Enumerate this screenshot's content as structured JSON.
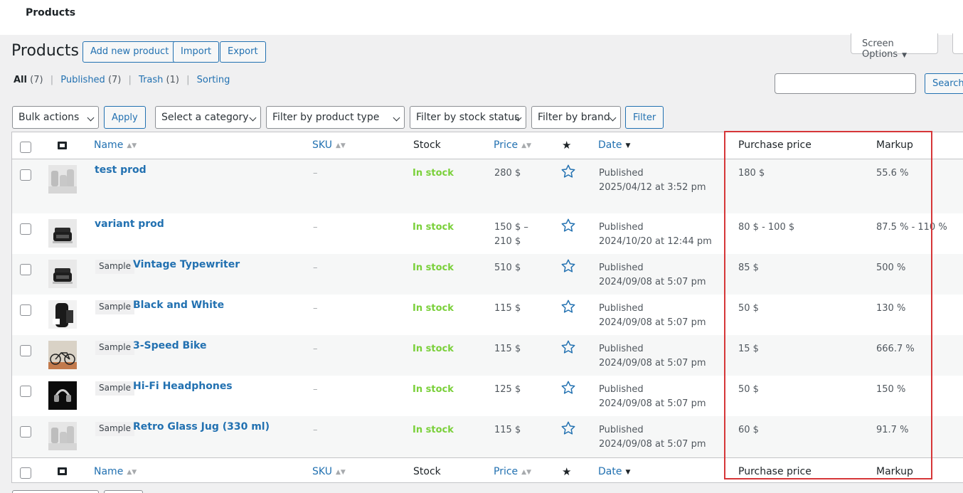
{
  "topbar": {
    "title": "Products"
  },
  "screen_options": {
    "label": "Screen Options",
    "arrow": "▼"
  },
  "page": {
    "heading": "Products",
    "buttons": {
      "add_new": "Add new product",
      "import": "Import",
      "export": "Export"
    }
  },
  "views": {
    "all": {
      "label": "All",
      "count": "(7)"
    },
    "published": {
      "label": "Published",
      "count": "(7)"
    },
    "trash": {
      "label": "Trash",
      "count": "(1)"
    },
    "sorting": {
      "label": "Sorting"
    },
    "separator": "|"
  },
  "search": {
    "value": "",
    "button": "Search"
  },
  "filters": {
    "bulk_actions": "Bulk actions",
    "apply": "Apply",
    "category": "Select a category",
    "product_type": "Filter by product type",
    "stock_status": "Filter by stock status",
    "brand": "Filter by brand",
    "filter_button": "Filter"
  },
  "columns": {
    "name": "Name",
    "sku": "SKU",
    "stock": "Stock",
    "price": "Price",
    "date": "Date",
    "purchase_price": "Purchase price",
    "markup": "Markup"
  },
  "icons": {
    "thumbnail_column": "image-icon",
    "featured_column": "star-icon",
    "sort": "sort-arrows-icon",
    "sort_desc": "sort-desc-icon"
  },
  "products": [
    {
      "name": "test prod",
      "sample": "",
      "sku": "–",
      "stock": "In stock",
      "price1": "280 $",
      "price2": "",
      "status": "Published",
      "date": "2025/04/12 at 3:52 pm",
      "purchase": "180 $",
      "markup": "55.6 %",
      "thumb": "jug"
    },
    {
      "name": "variant prod",
      "sample": "",
      "sku": "–",
      "stock": "In stock",
      "price1": "150 $ –",
      "price2": "210 $",
      "status": "Published",
      "date": "2024/10/20 at 12:44 pm",
      "purchase": "80 $ - 100 $",
      "markup": "87.5 % - 110 %",
      "thumb": "typewriter"
    },
    {
      "name": "Vintage Typewriter",
      "sample": "Sample",
      "sku": "–",
      "stock": "In stock",
      "price1": "510 $",
      "price2": "",
      "status": "Published",
      "date": "2024/09/08 at 5:07 pm",
      "purchase": "85 $",
      "markup": "500 %",
      "thumb": "typewriter"
    },
    {
      "name": "Black and White",
      "sample": "Sample",
      "sku": "–",
      "stock": "In stock",
      "price1": "115 $",
      "price2": "",
      "status": "Published",
      "date": "2024/09/08 at 5:07 pm",
      "purchase": "50 $",
      "markup": "130 %",
      "thumb": "bw"
    },
    {
      "name": "3-Speed Bike",
      "sample": "Sample",
      "sku": "–",
      "stock": "In stock",
      "price1": "115 $",
      "price2": "",
      "status": "Published",
      "date": "2024/09/08 at 5:07 pm",
      "purchase": "15 $",
      "markup": "666.7 %",
      "thumb": "bike"
    },
    {
      "name": "Hi-Fi Headphones",
      "sample": "Sample",
      "sku": "–",
      "stock": "In stock",
      "price1": "125 $",
      "price2": "",
      "status": "Published",
      "date": "2024/09/08 at 5:07 pm",
      "purchase": "50 $",
      "markup": "150 %",
      "thumb": "headphones"
    },
    {
      "name": "Retro Glass Jug (330 ml)",
      "sample": "Sample",
      "sku": "–",
      "stock": "In stock",
      "price1": "115 $",
      "price2": "",
      "status": "Published",
      "date": "2024/09/08 at 5:07 pm",
      "purchase": "60 $",
      "markup": "91.7 %",
      "thumb": "jug"
    }
  ],
  "colors": {
    "link": "#2271b1",
    "in_stock": "#7ad03a",
    "highlight": "#d63638"
  }
}
